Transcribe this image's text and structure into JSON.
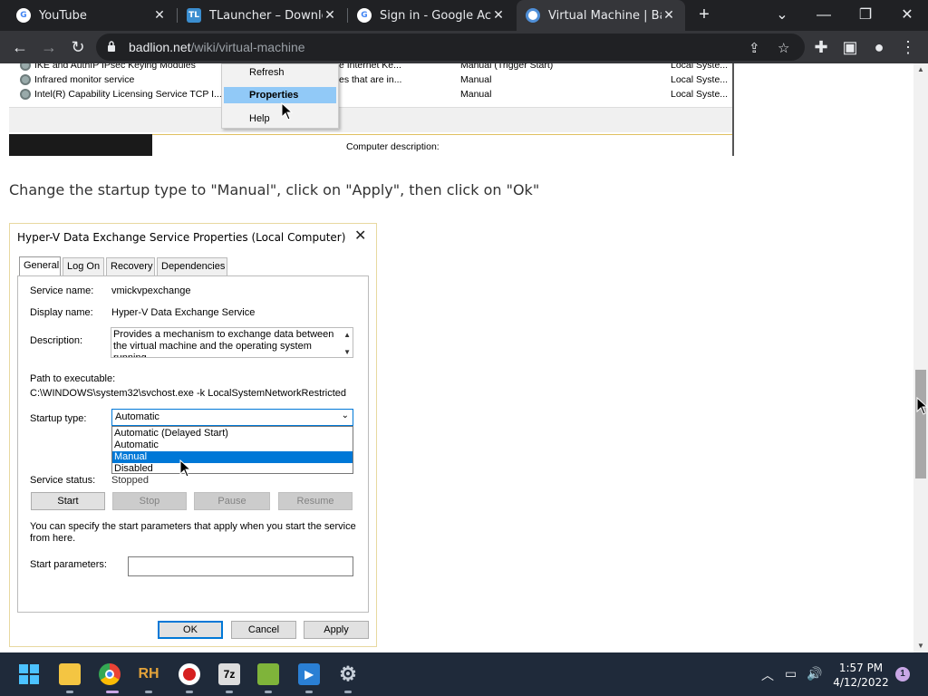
{
  "browser": {
    "tabs": [
      {
        "title": "YouTube",
        "favicon": "google-g-icon"
      },
      {
        "title": "TLauncher – Download",
        "favicon": "tl-icon",
        "favicon_text": "TL"
      },
      {
        "title": "Sign in - Google Accou",
        "favicon": "google-g-icon"
      },
      {
        "title": "Virtual Machine | Badlin",
        "favicon": "badlion-icon",
        "active": true
      }
    ],
    "new_tab": "+",
    "url_domain": "badlion.net",
    "url_path": "/wiki/virtual-machine"
  },
  "services_shot": {
    "rows": [
      {
        "name": "IKE and AuthIP IPsec Keying Modules",
        "desc": "e Internet Ke...",
        "startup": "Manual (Trigger Start)",
        "logon": "Local Syste..."
      },
      {
        "name": "Infrared monitor service",
        "desc": "es that are in...",
        "startup": "Manual",
        "logon": "Local Syste..."
      },
      {
        "name": "Intel(R) Capability Licensing Service TCP I...",
        "desc": "",
        "startup": "Manual",
        "logon": "Local Syste..."
      }
    ],
    "computer_description": "Computer description:",
    "context_menu": [
      "Refresh",
      "Properties",
      "Help"
    ]
  },
  "instruction": "Change the startup type to \"Manual\", click on \"Apply\", then click on \"Ok\"",
  "dialog": {
    "title": "Hyper-V Data Exchange Service Properties (Local Computer)",
    "tabs": [
      "General",
      "Log On",
      "Recovery",
      "Dependencies"
    ],
    "service_name_label": "Service name:",
    "service_name": "vmickvpexchange",
    "display_name_label": "Display name:",
    "display_name": "Hyper-V Data Exchange Service",
    "description_label": "Description:",
    "description": "Provides a mechanism to exchange data between the virtual machine and the operating system running",
    "path_label": "Path to executable:",
    "path": "C:\\WINDOWS\\system32\\svchost.exe -k LocalSystemNetworkRestricted",
    "startup_type_label": "Startup type:",
    "startup_type_value": "Automatic",
    "startup_options": [
      "Automatic (Delayed Start)",
      "Automatic",
      "Manual",
      "Disabled"
    ],
    "selected_option": "Manual",
    "service_status_label": "Service status:",
    "service_status": "Stopped",
    "buttons": {
      "start": "Start",
      "stop": "Stop",
      "pause": "Pause",
      "resume": "Resume"
    },
    "params_hint": "You can specify the start parameters that apply when you start the service from here.",
    "start_params_label": "Start parameters:",
    "ok": "OK",
    "cancel": "Cancel",
    "apply": "Apply"
  },
  "taskbar": {
    "apps": [
      "windows-start-icon",
      "file-explorer-icon",
      "chrome-icon",
      "rh-icon",
      "recorder-icon",
      "7zip-icon",
      "notepad-icon",
      "media-icon",
      "settings-icon"
    ],
    "rh_text": "RH",
    "zip_text": "7z",
    "time": "1:57 PM",
    "date": "4/12/2022",
    "notification_count": "1"
  },
  "colors": {
    "chrome_dark": "#202124",
    "chrome_toolbar": "#35363a",
    "selection_blue": "#0078d7",
    "taskbar": "#1f2a3a"
  }
}
